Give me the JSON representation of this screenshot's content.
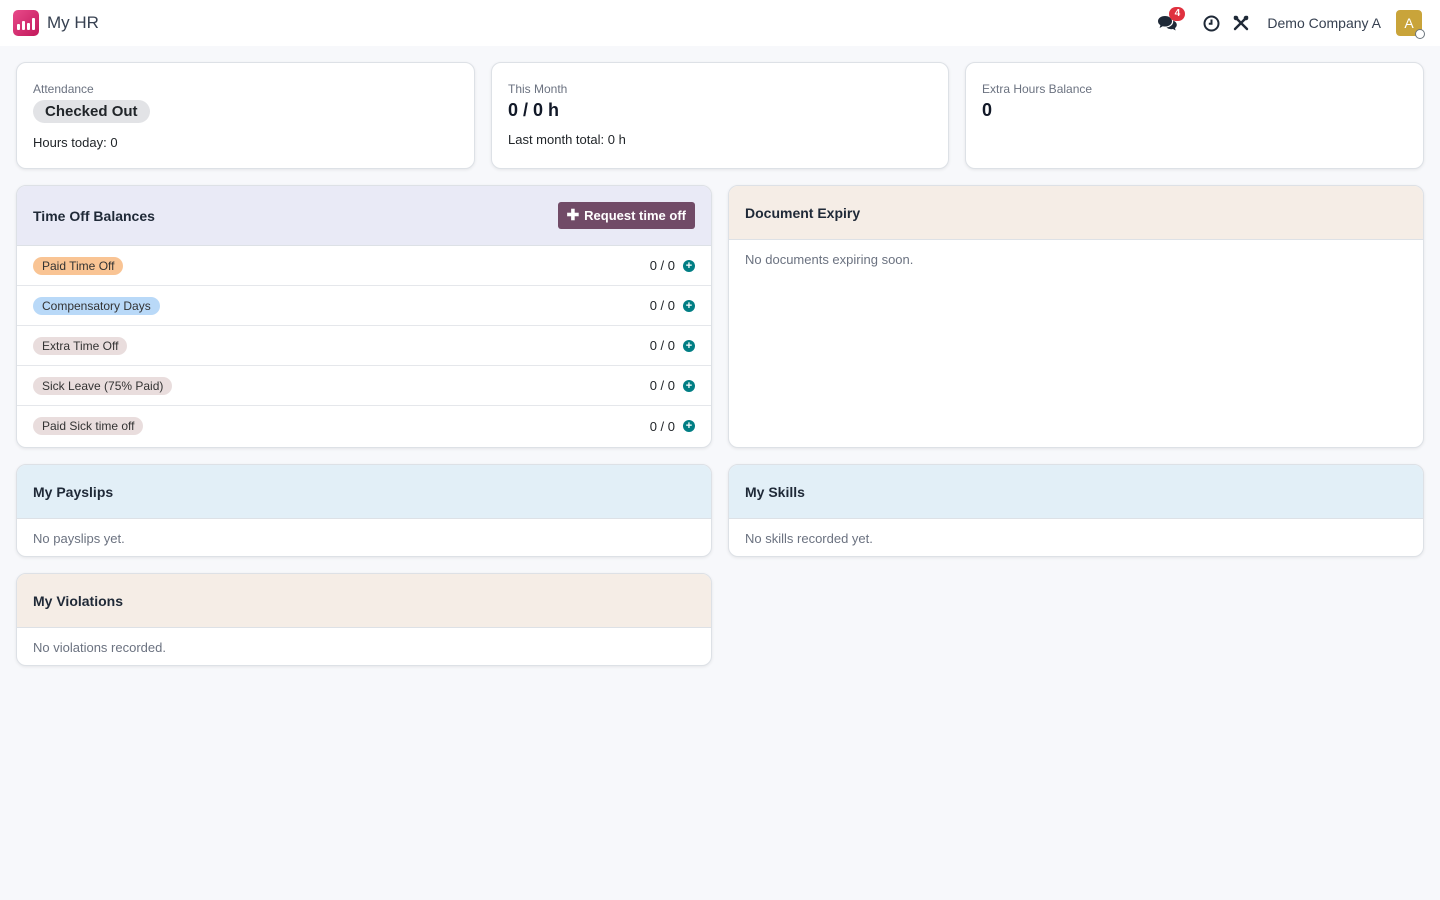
{
  "app": {
    "title": "My HR"
  },
  "navbar": {
    "messages_badge": "4",
    "company": "Demo Company A",
    "avatar_letter": "A"
  },
  "stats": {
    "attendance": {
      "label": "Attendance",
      "status": "Checked Out",
      "hours_today": "Hours today: 0"
    },
    "this_month": {
      "label": "This Month",
      "value": "0 / 0 h",
      "last_month": "Last month total: 0 h"
    },
    "extra_hours": {
      "label": "Extra Hours Balance",
      "value": "0"
    }
  },
  "time_off": {
    "title": "Time Off Balances",
    "request_button": "Request time off",
    "rows": [
      {
        "label": "Paid Time Off",
        "value": "0 / 0",
        "chip_color": "#f9c494"
      },
      {
        "label": "Compensatory Days",
        "value": "0 / 0",
        "chip_color": "#b9d9f8"
      },
      {
        "label": "Extra Time Off",
        "value": "0 / 0",
        "chip_color": "#e9dddd"
      },
      {
        "label": "Sick Leave (75% Paid)",
        "value": "0 / 0",
        "chip_color": "#e9dddd"
      },
      {
        "label": "Paid Sick time off",
        "value": "0 / 0",
        "chip_color": "#e9dddd"
      }
    ]
  },
  "document_expiry": {
    "title": "Document Expiry",
    "empty": "No documents expiring soon.",
    "header_color": "#f5ede6"
  },
  "payslips": {
    "title": "My Payslips",
    "empty": "No payslips yet.",
    "header_color": "#e2eff7"
  },
  "skills": {
    "title": "My Skills",
    "empty": "No skills recorded yet.",
    "header_color": "#e2eff7"
  },
  "violations": {
    "title": "My Violations",
    "empty": "No violations recorded.",
    "header_color": "#f5ede6"
  },
  "colors": {
    "accent": "#714b67",
    "teal": "#017e84",
    "timeoff_header": "#e9eaf6"
  }
}
